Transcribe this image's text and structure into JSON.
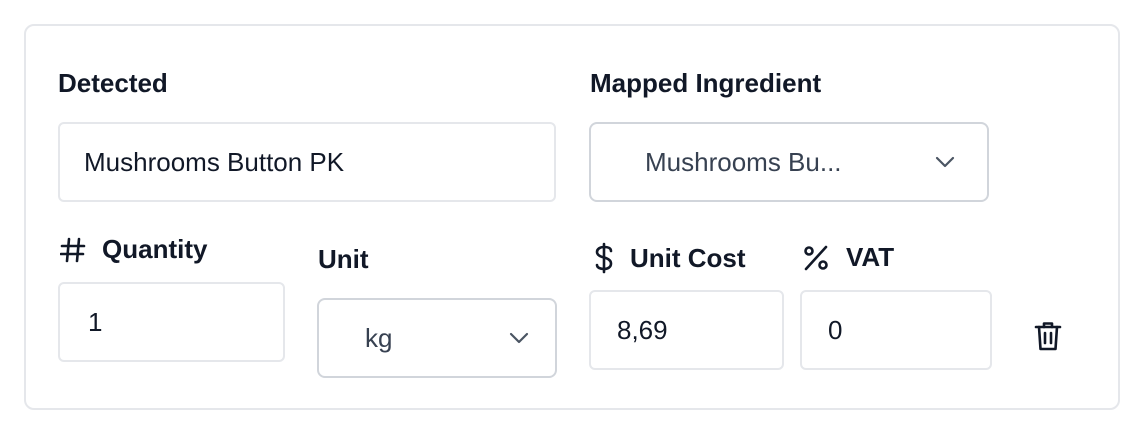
{
  "detected": {
    "label": "Detected",
    "value": "Mushrooms Button PK"
  },
  "mapped_ingredient": {
    "label": "Mapped Ingredient",
    "selected": "Mushrooms Bu..."
  },
  "quantity": {
    "label": "Quantity",
    "icon": "hash-icon",
    "value": "1"
  },
  "unit": {
    "label": "Unit",
    "selected": "kg"
  },
  "unit_cost": {
    "label": "Unit Cost",
    "icon": "dollar-icon",
    "value": "8,69"
  },
  "vat": {
    "label": "VAT",
    "icon": "percent-icon",
    "value": "0"
  },
  "actions": {
    "delete_icon": "trash-icon"
  },
  "colors": {
    "border": "#e5e7eb",
    "select_border": "#d1d5db",
    "text": "#111827",
    "muted_text": "#374151"
  }
}
